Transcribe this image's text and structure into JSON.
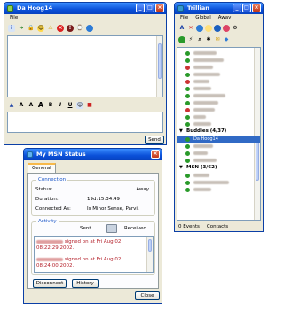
{
  "chat_window": {
    "title": "Da Hoog14",
    "menu": [
      "File"
    ],
    "send_label": "Send"
  },
  "trillian_window": {
    "title": "Trillian",
    "menu": [
      "File",
      "Global",
      "Away"
    ],
    "groups": [
      {
        "name": "Buddies (4/37)"
      },
      {
        "name": "MSN (3/62)"
      }
    ],
    "highlighted_contact": "Da Hoog14",
    "status_events": "0 Events",
    "status_contacts": "Contacts"
  },
  "msn_status_window": {
    "title": "My MSN Status",
    "tab": "General",
    "connection_legend": "Connection",
    "status_label": "Status:",
    "status_value": "Away",
    "duration_label": "Duration:",
    "duration_value": "19d:15:34:49",
    "connected_as_label": "Connected As:",
    "connected_as_value": "Is Minor Sense, Parvi.",
    "activity_legend": "Activity",
    "sent_label": "Sent",
    "received_label": "Received",
    "log": [
      {
        "text": "signed on at Fri Aug 02 08:22:29 2002."
      },
      {
        "text": "signed on at Fri Aug 02 08:24:00 2002."
      }
    ],
    "disconnect_label": "Disconnect",
    "history_label": "History",
    "close_label": "Close"
  }
}
